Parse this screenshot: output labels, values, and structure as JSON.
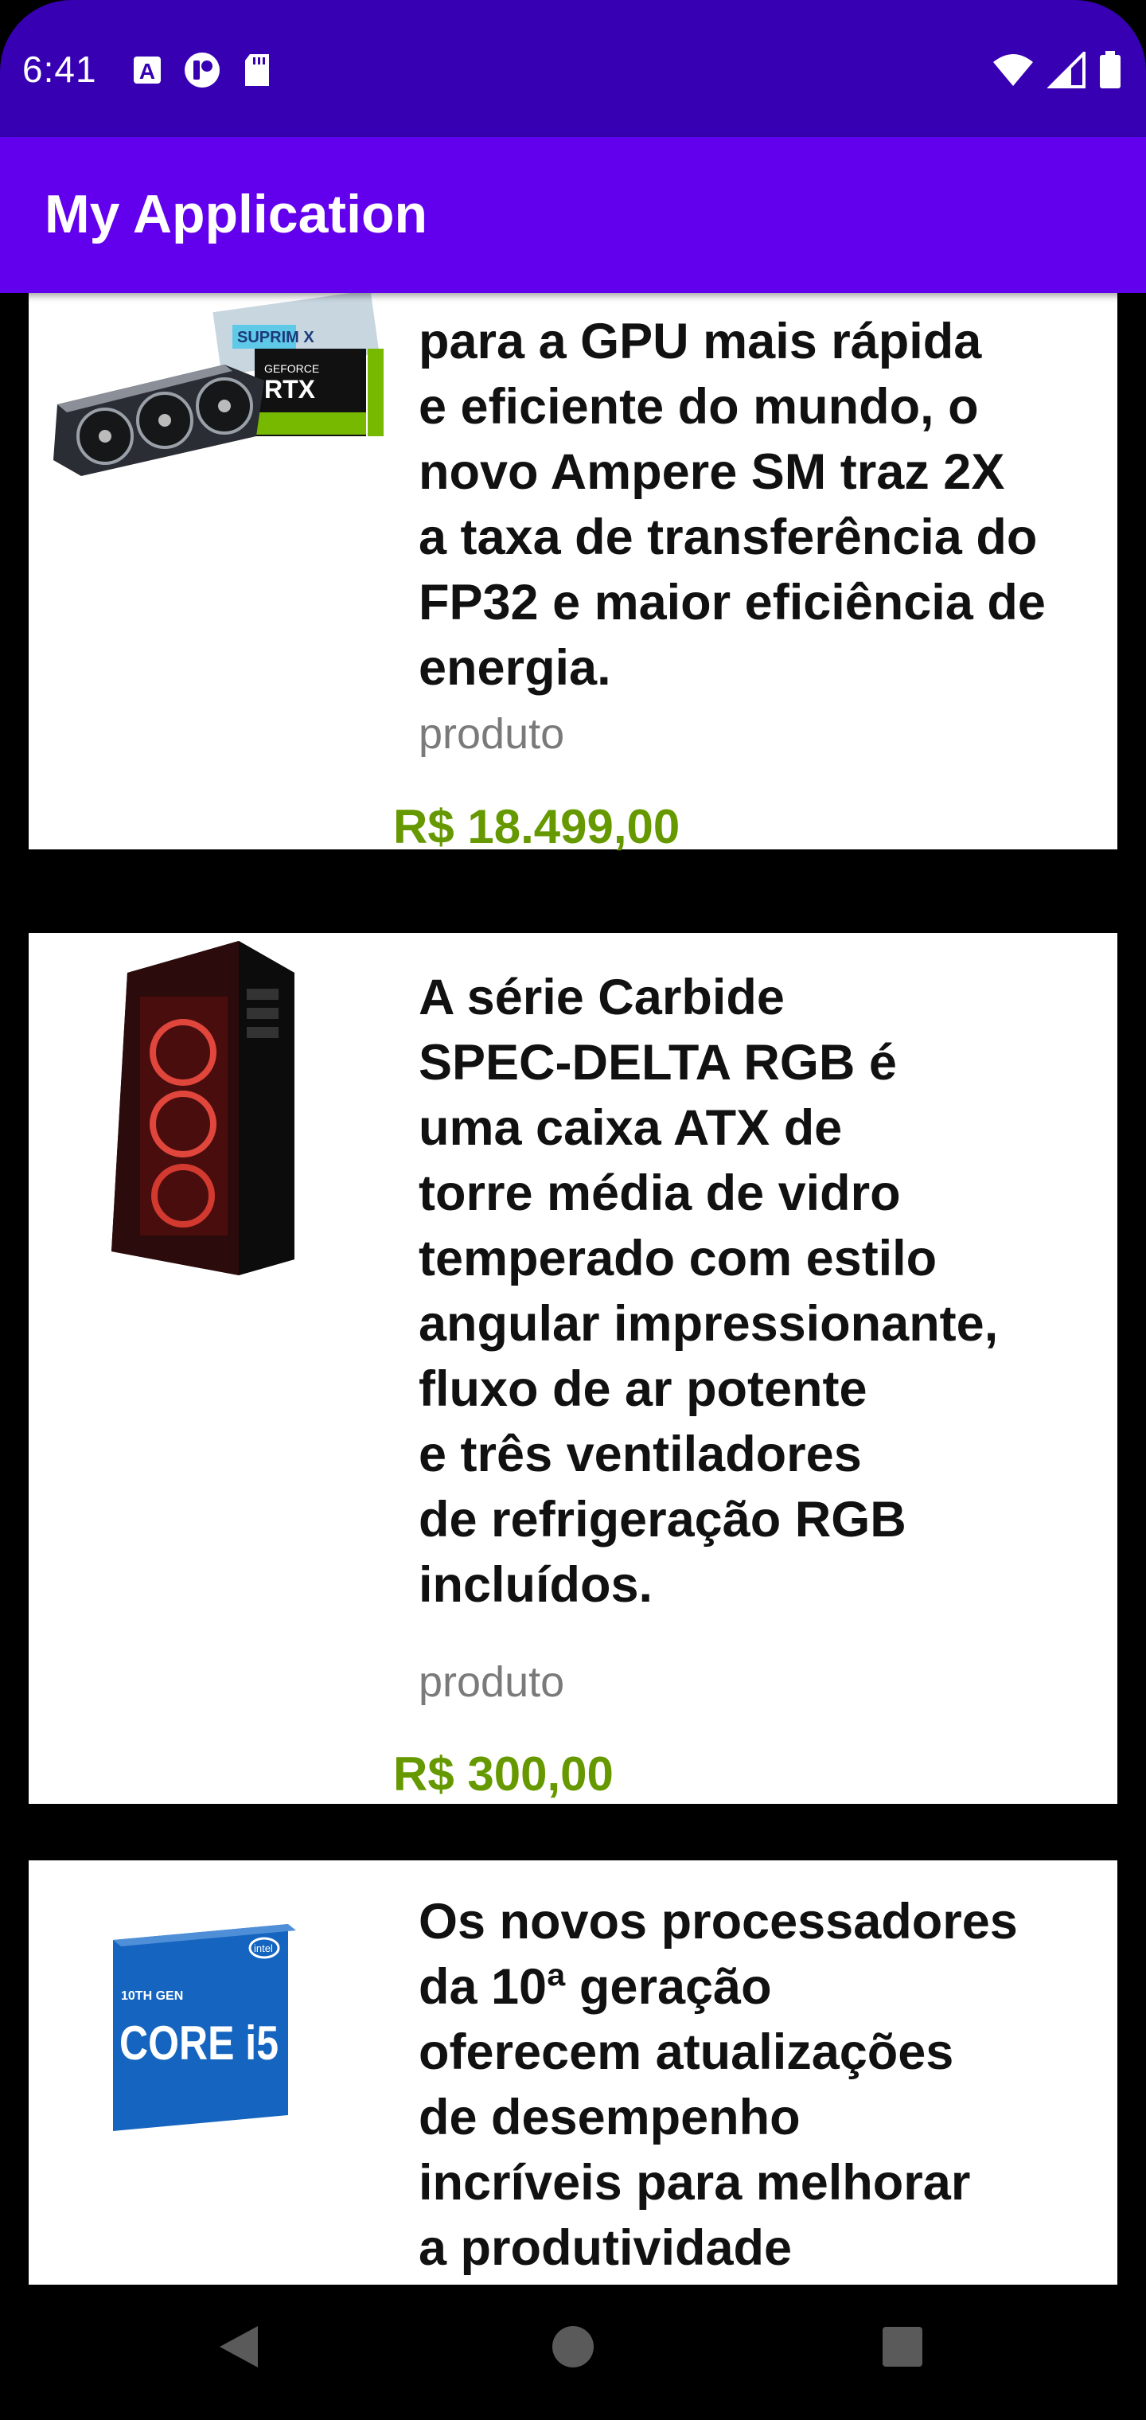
{
  "status_bar": {
    "time": "6:41",
    "left_icons": [
      "a-box-icon",
      "podcast-icon",
      "sd-card-icon"
    ],
    "right_icons": [
      "wifi-icon",
      "cell-signal-icon",
      "battery-icon"
    ]
  },
  "app_bar": {
    "title": "My Application"
  },
  "colors": {
    "status_bar": "#3700B3",
    "app_bar": "#6200EE",
    "price": "#669900",
    "type_text": "#7a7a7a",
    "background": "#000000"
  },
  "products": [
    {
      "image_icon": "gpu-graphics-card-icon",
      "description_lines": [
        "para a GPU mais rápida",
        "e eficiente do mundo, o",
        "novo Ampere SM traz 2X",
        "a taxa de transferência do",
        "FP32 e maior eficiência de",
        "energia."
      ],
      "type": "produto",
      "price": "R$ 18.499,00"
    },
    {
      "image_icon": "pc-case-icon",
      "description_lines": [
        "A série Carbide",
        "SPEC-DELTA RGB é",
        "uma caixa ATX de",
        "torre média de vidro",
        "temperado com estilo",
        "angular impressionante,",
        "fluxo de ar potente",
        "e três ventiladores",
        "de refrigeração RGB",
        "incluídos."
      ],
      "type": "produto",
      "price": "R$ 300,00"
    },
    {
      "image_icon": "cpu-box-icon",
      "image_text": [
        "10TH GEN",
        "CORE i5",
        "intel"
      ],
      "description_lines": [
        "Os novos processadores",
        "da 10ª geração",
        "oferecem atualizações",
        "de desempenho",
        "incríveis para melhorar",
        "a produtividade"
      ]
    }
  ],
  "nav_bar": {
    "buttons": [
      "back-icon",
      "home-icon",
      "recents-icon"
    ]
  }
}
